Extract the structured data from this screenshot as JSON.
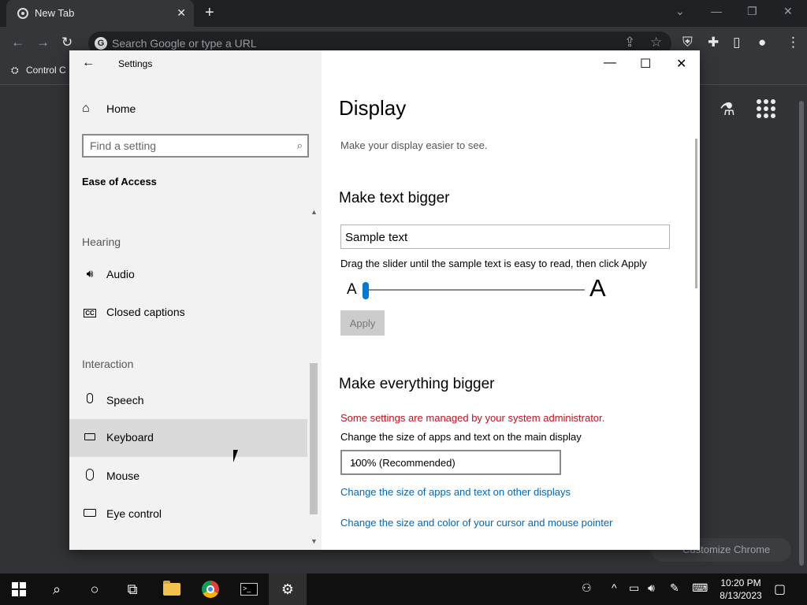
{
  "browser": {
    "tab_title": "New Tab",
    "omnibox_placeholder": "Search Google or type a URL",
    "bookmark_label": "Control C",
    "customize_label": "Customize Chrome"
  },
  "settings": {
    "window_title": "Settings",
    "home_label": "Home",
    "search_placeholder": "Find a setting",
    "category_title": "Ease of Access",
    "groups": {
      "hearing": "Hearing",
      "interaction": "Interaction"
    },
    "nav": {
      "audio": "Audio",
      "closed_captions": "Closed captions",
      "speech": "Speech",
      "keyboard": "Keyboard",
      "mouse": "Mouse",
      "eye_control": "Eye control"
    },
    "selected_nav": "keyboard"
  },
  "display": {
    "title": "Display",
    "subtitle": "Make your display easier to see.",
    "text_section": {
      "title": "Make text bigger",
      "sample_text": "Sample text",
      "instruction": "Drag the slider until the sample text is easy to read, then click Apply",
      "slider_min_label": "A",
      "slider_max_label": "A",
      "slider_value_fraction": 0.0,
      "apply_label": "Apply"
    },
    "everything_section": {
      "title": "Make everything bigger",
      "admin_warning": "Some settings are managed by your system administrator.",
      "size_label": "Change the size of apps and text on the main display",
      "size_value": "100% (Recommended)",
      "link_other_displays": "Change the size of apps and text on other displays",
      "link_cursor": "Change the size and color of your cursor and mouse pointer"
    }
  },
  "taskbar": {
    "time": "10:20 PM",
    "date": "8/13/2023"
  },
  "colors": {
    "accent": "#0078d4",
    "warning": "#c50f1f",
    "link": "#0067b8"
  }
}
